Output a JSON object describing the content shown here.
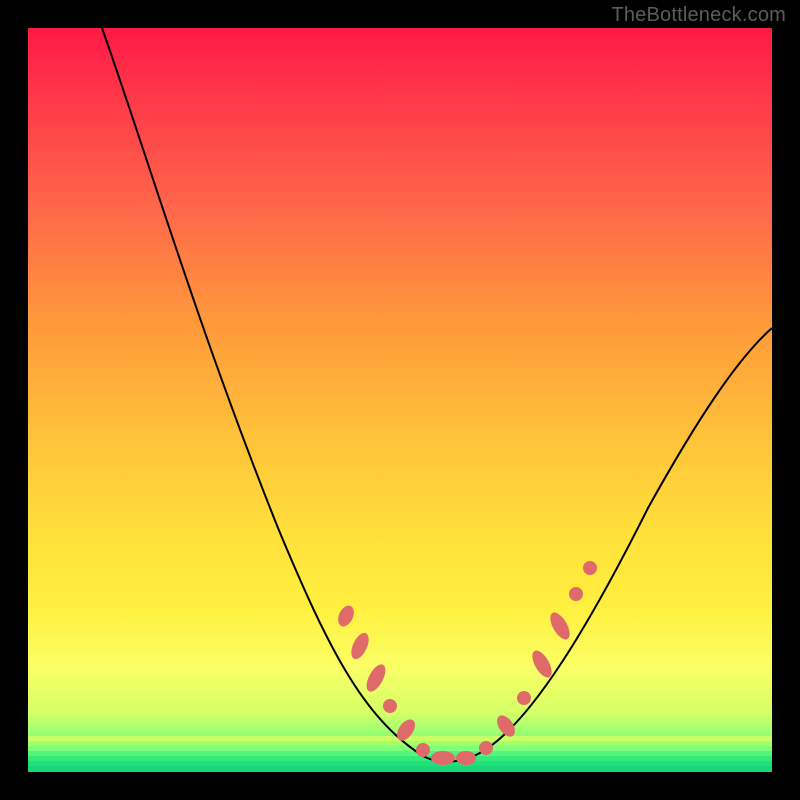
{
  "watermark": "TheBottleneck.com",
  "colors": {
    "background": "#000000",
    "gradient_top": "#ff1a46",
    "gradient_bottom": "#18e07a",
    "curve": "#000000",
    "markers": "#e06a6a"
  },
  "chart_data": {
    "type": "line",
    "title": "",
    "xlabel": "",
    "ylabel": "",
    "xlim": [
      0,
      100
    ],
    "ylim": [
      0,
      100
    ],
    "grid": false,
    "series": [
      {
        "name": "bottleneck-curve",
        "x": [
          10,
          15,
          20,
          25,
          30,
          35,
          40,
          44,
          47,
          50,
          53,
          56,
          59,
          63,
          67,
          72,
          78,
          85,
          92,
          100
        ],
        "values": [
          100,
          88,
          74,
          60,
          47,
          35,
          24,
          15,
          9,
          5,
          3,
          2,
          3,
          6,
          12,
          20,
          30,
          40,
          49,
          58
        ]
      }
    ],
    "markers": {
      "name": "highlight-points",
      "x": [
        42,
        44,
        46,
        48,
        50,
        52,
        54,
        56,
        58,
        60,
        62,
        65,
        67,
        69,
        71
      ],
      "values": [
        18,
        14,
        11,
        8,
        5,
        3,
        2.5,
        2.5,
        3,
        5,
        8,
        12,
        15,
        18,
        21
      ]
    }
  }
}
